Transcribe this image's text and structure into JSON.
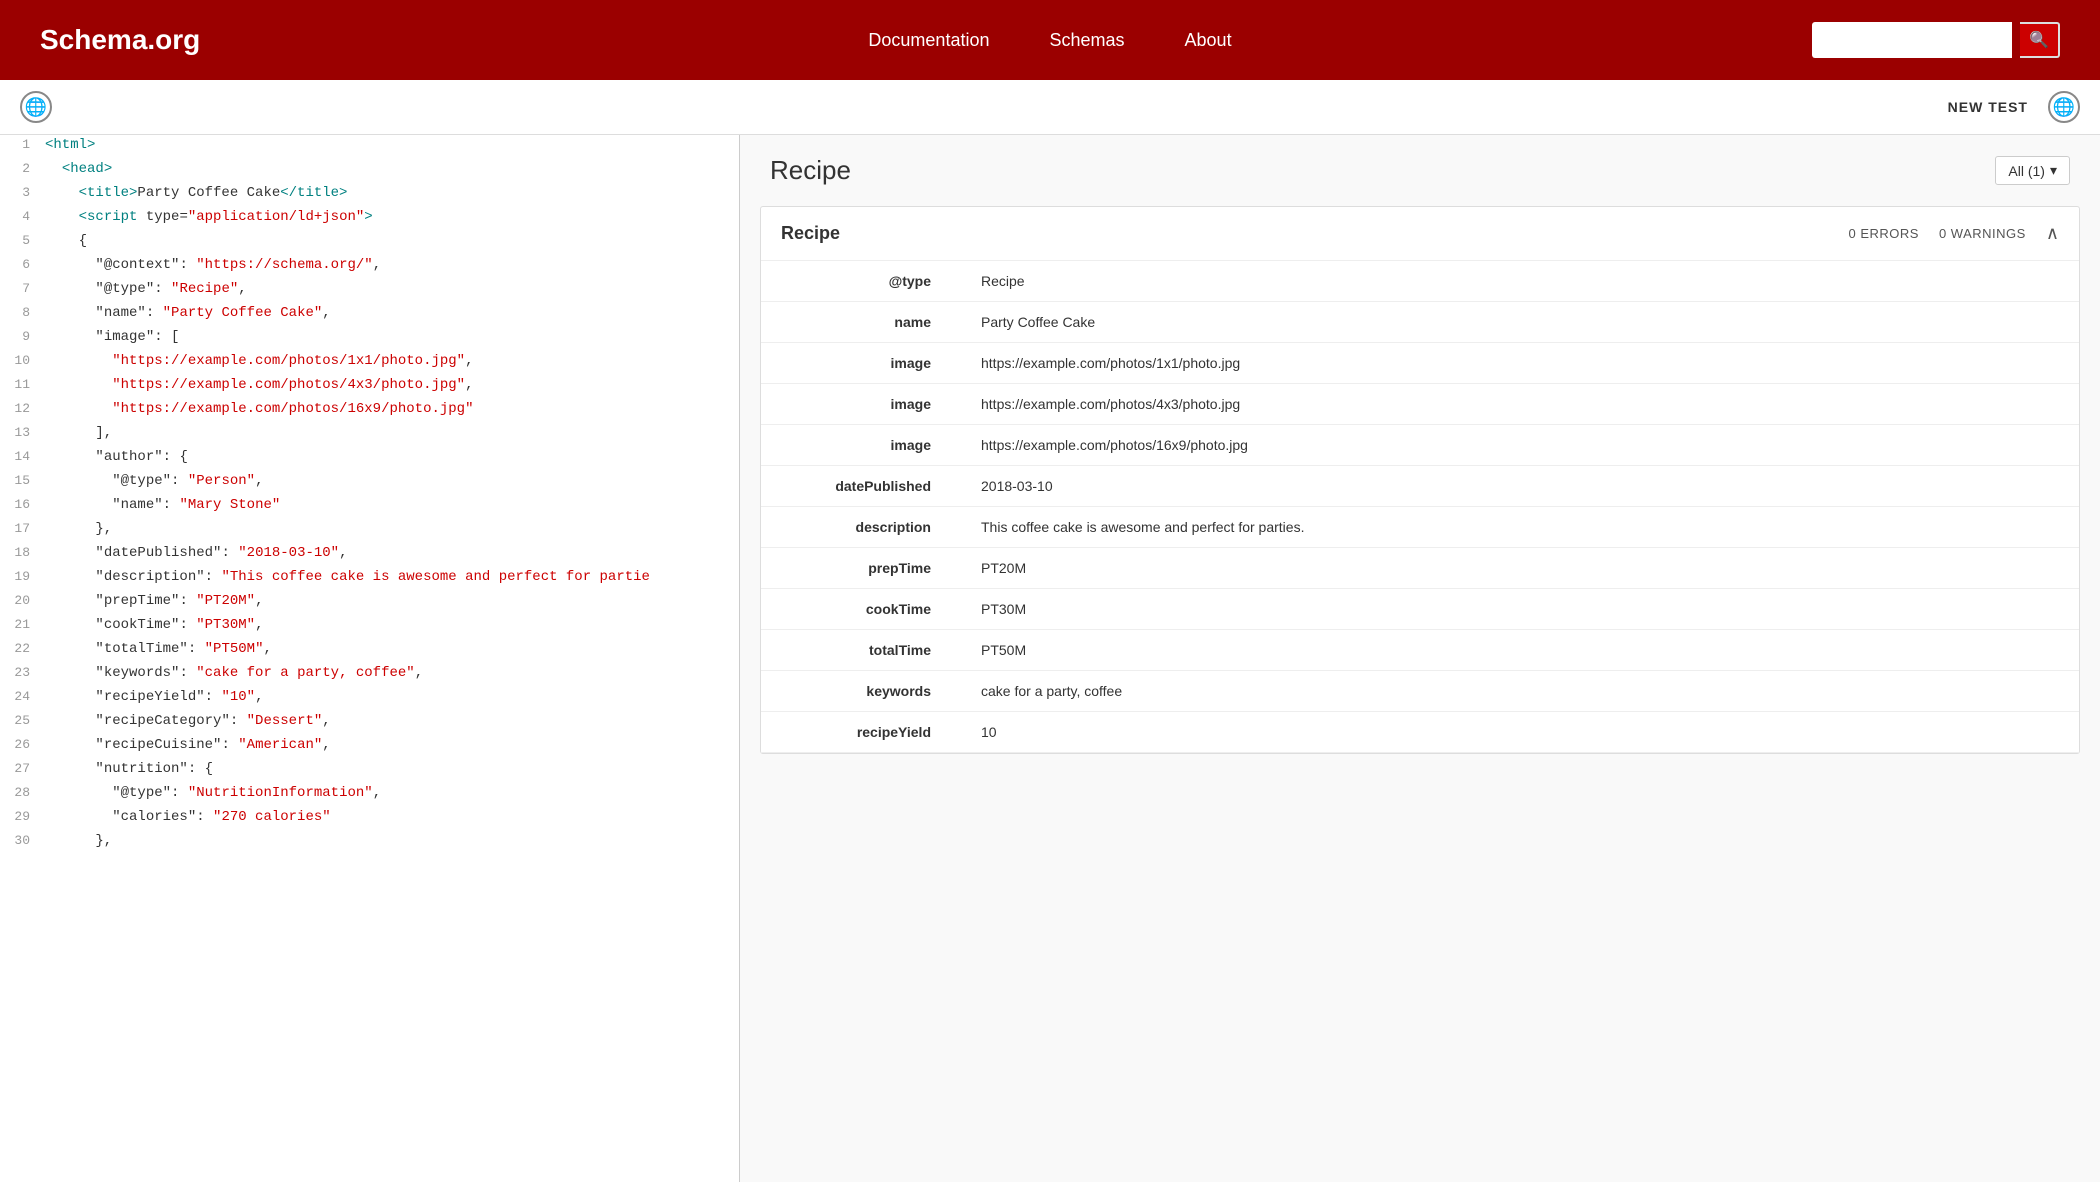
{
  "header": {
    "logo": "Schema.org",
    "nav": {
      "documentation": "Documentation",
      "schemas": "Schemas",
      "about": "About"
    },
    "search_placeholder": ""
  },
  "toolbar": {
    "new_test_label": "NEW TEST"
  },
  "results": {
    "title": "Recipe",
    "filter_label": "All (1)",
    "card": {
      "title": "Recipe",
      "errors": "0 ERRORS",
      "warnings": "0 WARNINGS"
    },
    "table_rows": [
      {
        "key": "@type",
        "value": "Recipe"
      },
      {
        "key": "name",
        "value": "Party Coffee Cake"
      },
      {
        "key": "image",
        "value": "https://example.com/photos/1x1/photo.jpg"
      },
      {
        "key": "image",
        "value": "https://example.com/photos/4x3/photo.jpg"
      },
      {
        "key": "image",
        "value": "https://example.com/photos/16x9/photo.jpg"
      },
      {
        "key": "datePublished",
        "value": "2018-03-10"
      },
      {
        "key": "description",
        "value": "This coffee cake is awesome and perfect for parties."
      },
      {
        "key": "prepTime",
        "value": "PT20M"
      },
      {
        "key": "cookTime",
        "value": "PT30M"
      },
      {
        "key": "totalTime",
        "value": "PT50M"
      },
      {
        "key": "keywords",
        "value": "cake for a party, coffee"
      },
      {
        "key": "recipeYield",
        "value": "10"
      }
    ]
  },
  "code": {
    "lines": [
      {
        "num": 1,
        "html": "<span class='kw'>&lt;html&gt;</span>"
      },
      {
        "num": 2,
        "html": "  <span class='kw'>&lt;head&gt;</span>"
      },
      {
        "num": 3,
        "html": "    <span class='kw'>&lt;title&gt;</span>Party Coffee Cake<span class='kw'>&lt;/title&gt;</span>"
      },
      {
        "num": 4,
        "html": "    <span class='kw'>&lt;script</span> <span class='attr'>type</span>=<span class='str'>\"application/ld+json\"</span><span class='kw'>&gt;</span>"
      },
      {
        "num": 5,
        "html": "    {"
      },
      {
        "num": 6,
        "html": "      <span class='attr'>\"@context\"</span>: <span class='str'>\"https://schema.org/\"</span>,"
      },
      {
        "num": 7,
        "html": "      <span class='attr'>\"@type\"</span>: <span class='str'>\"Recipe\"</span>,"
      },
      {
        "num": 8,
        "html": "      <span class='attr'>\"name\"</span>: <span class='str'>\"Party Coffee Cake\"</span>,"
      },
      {
        "num": 9,
        "html": "      <span class='attr'>\"image\"</span>: ["
      },
      {
        "num": 10,
        "html": "        <span class='str'>\"https://example.com/photos/1x1/photo.jpg\"</span>,"
      },
      {
        "num": 11,
        "html": "        <span class='str'>\"https://example.com/photos/4x3/photo.jpg\"</span>,"
      },
      {
        "num": 12,
        "html": "        <span class='str'>\"https://example.com/photos/16x9/photo.jpg\"</span>"
      },
      {
        "num": 13,
        "html": "      ],"
      },
      {
        "num": 14,
        "html": "      <span class='attr'>\"author\"</span>: {"
      },
      {
        "num": 15,
        "html": "        <span class='attr'>\"@type\"</span>: <span class='str'>\"Person\"</span>,"
      },
      {
        "num": 16,
        "html": "        <span class='attr'>\"name\"</span>: <span class='str'>\"Mary Stone\"</span>"
      },
      {
        "num": 17,
        "html": "      },"
      },
      {
        "num": 18,
        "html": "      <span class='attr'>\"datePublished\"</span>: <span class='str'>\"2018-03-10\"</span>,"
      },
      {
        "num": 19,
        "html": "      <span class='attr'>\"description\"</span>: <span class='str'>\"This coffee cake is awesome and perfect for partie</span>"
      },
      {
        "num": 20,
        "html": "      <span class='attr'>\"prepTime\"</span>: <span class='str'>\"PT20M\"</span>,"
      },
      {
        "num": 21,
        "html": "      <span class='attr'>\"cookTime\"</span>: <span class='str'>\"PT30M\"</span>,"
      },
      {
        "num": 22,
        "html": "      <span class='attr'>\"totalTime\"</span>: <span class='str'>\"PT50M\"</span>,"
      },
      {
        "num": 23,
        "html": "      <span class='attr'>\"keywords\"</span>: <span class='str'>\"cake for a party, coffee\"</span>,"
      },
      {
        "num": 24,
        "html": "      <span class='attr'>\"recipeYield\"</span>: <span class='str'>\"10\"</span>,"
      },
      {
        "num": 25,
        "html": "      <span class='attr'>\"recipeCategory\"</span>: <span class='str'>\"Dessert\"</span>,"
      },
      {
        "num": 26,
        "html": "      <span class='attr'>\"recipeCuisine\"</span>: <span class='str'>\"American\"</span>,"
      },
      {
        "num": 27,
        "html": "      <span class='attr'>\"nutrition\"</span>: {"
      },
      {
        "num": 28,
        "html": "        <span class='attr'>\"@type\"</span>: <span class='str'>\"NutritionInformation\"</span>,"
      },
      {
        "num": 29,
        "html": "        <span class='attr'>\"calories\"</span>: <span class='str'>\"270 calories\"</span>"
      },
      {
        "num": 30,
        "html": "      },"
      }
    ]
  },
  "icons": {
    "globe": "🌐",
    "search": "🔍",
    "chevron_up": "∧",
    "chevron_down": "∨"
  }
}
